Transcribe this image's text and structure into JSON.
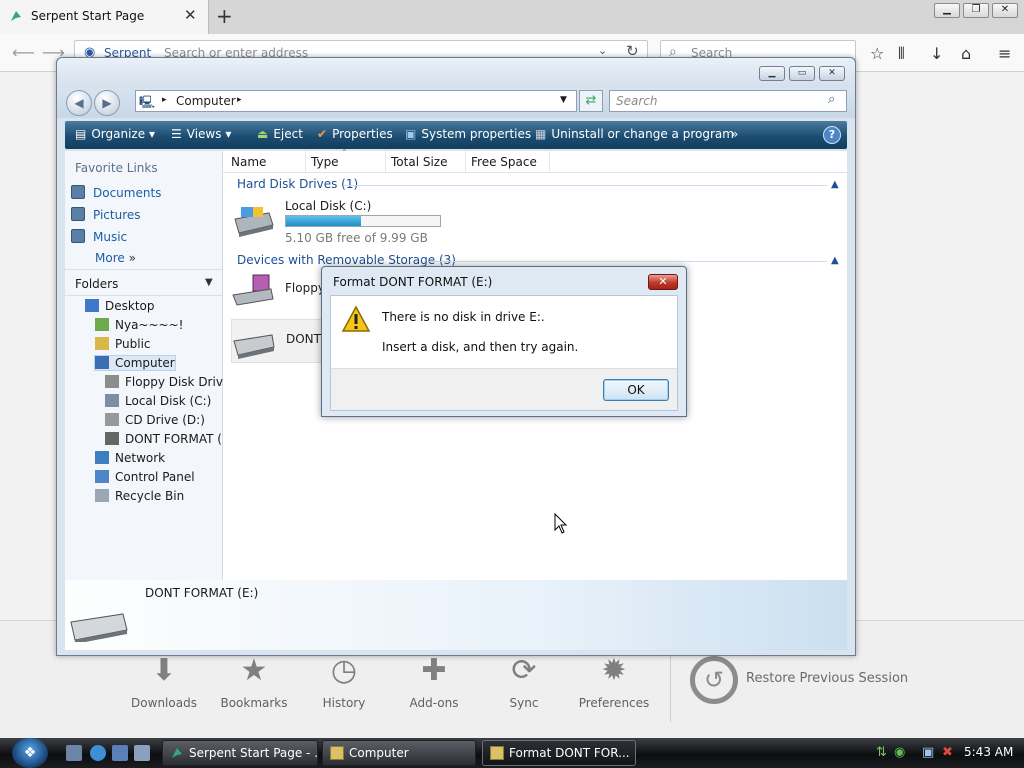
{
  "browser": {
    "tab_title": "Serpent Start Page",
    "tab_close": "✕",
    "newtab": "+",
    "url_brand": "Serpent",
    "url_placeholder": "Search or enter address",
    "search_placeholder": "Search",
    "win_buttons": [
      "▁",
      "❐",
      "✕"
    ]
  },
  "startpage": {
    "items": [
      {
        "label": "Downloads",
        "glyph": "⬇"
      },
      {
        "label": "Bookmarks",
        "glyph": "★"
      },
      {
        "label": "History",
        "glyph": "◷"
      },
      {
        "label": "Add-ons",
        "glyph": "✚"
      },
      {
        "label": "Sync",
        "glyph": "⟳"
      },
      {
        "label": "Preferences",
        "glyph": "✹"
      }
    ],
    "restore_label": "Restore Previous Session",
    "restore_glyph": "↺"
  },
  "explorer": {
    "address": "Computer",
    "search_placeholder": "Search",
    "toolbar": [
      {
        "label": "Organize",
        "arrow": "▾"
      },
      {
        "label": "Views",
        "arrow": "▾"
      },
      {
        "label": "Eject"
      },
      {
        "label": "Properties"
      },
      {
        "label": "System properties"
      },
      {
        "label": "Uninstall or change a program"
      },
      {
        "label": "»"
      }
    ],
    "help": "?",
    "favorite_links_header": "Favorite Links",
    "favorite_links": [
      "Documents",
      "Pictures",
      "Music"
    ],
    "more": "More",
    "more_glyph": "»",
    "folders_header": "Folders",
    "tree": [
      {
        "label": "Desktop",
        "level": 0
      },
      {
        "label": "Nya~~~~!",
        "level": 1
      },
      {
        "label": "Public",
        "level": 1
      },
      {
        "label": "Computer",
        "level": 1
      },
      {
        "label": "Floppy Disk Drive",
        "level": 2
      },
      {
        "label": "Local Disk (C:)",
        "level": 2
      },
      {
        "label": "CD Drive (D:)",
        "level": 2
      },
      {
        "label": "DONT FORMAT (E:",
        "level": 2
      },
      {
        "label": "Network",
        "level": 1
      },
      {
        "label": "Control Panel",
        "level": 1
      },
      {
        "label": "Recycle Bin",
        "level": 1
      }
    ],
    "columns": [
      "Name",
      "Type",
      "Total Size",
      "Free Space"
    ],
    "groups": [
      {
        "label": "Hard Disk Drives (1)"
      },
      {
        "label": "Devices with Removable Storage (3)"
      }
    ],
    "local_disk": {
      "name": "Local Disk (C:)",
      "free_text": "5.10 GB free of 9.99 GB",
      "used_fraction": 0.49
    },
    "floppy_label": "Floppy",
    "dont_label": "DONT",
    "details_name": "DONT FORMAT (E:)"
  },
  "dialog": {
    "title": "Format DONT FORMAT (E:)",
    "close": "✕",
    "message1": "There is no disk in drive E:.",
    "message2": "Insert a disk, and then try again.",
    "ok": "OK"
  },
  "taskbar": {
    "tasks": [
      "Serpent Start Page - ...",
      "Computer",
      "Format DONT FOR..."
    ],
    "clock": "5:43 AM"
  }
}
